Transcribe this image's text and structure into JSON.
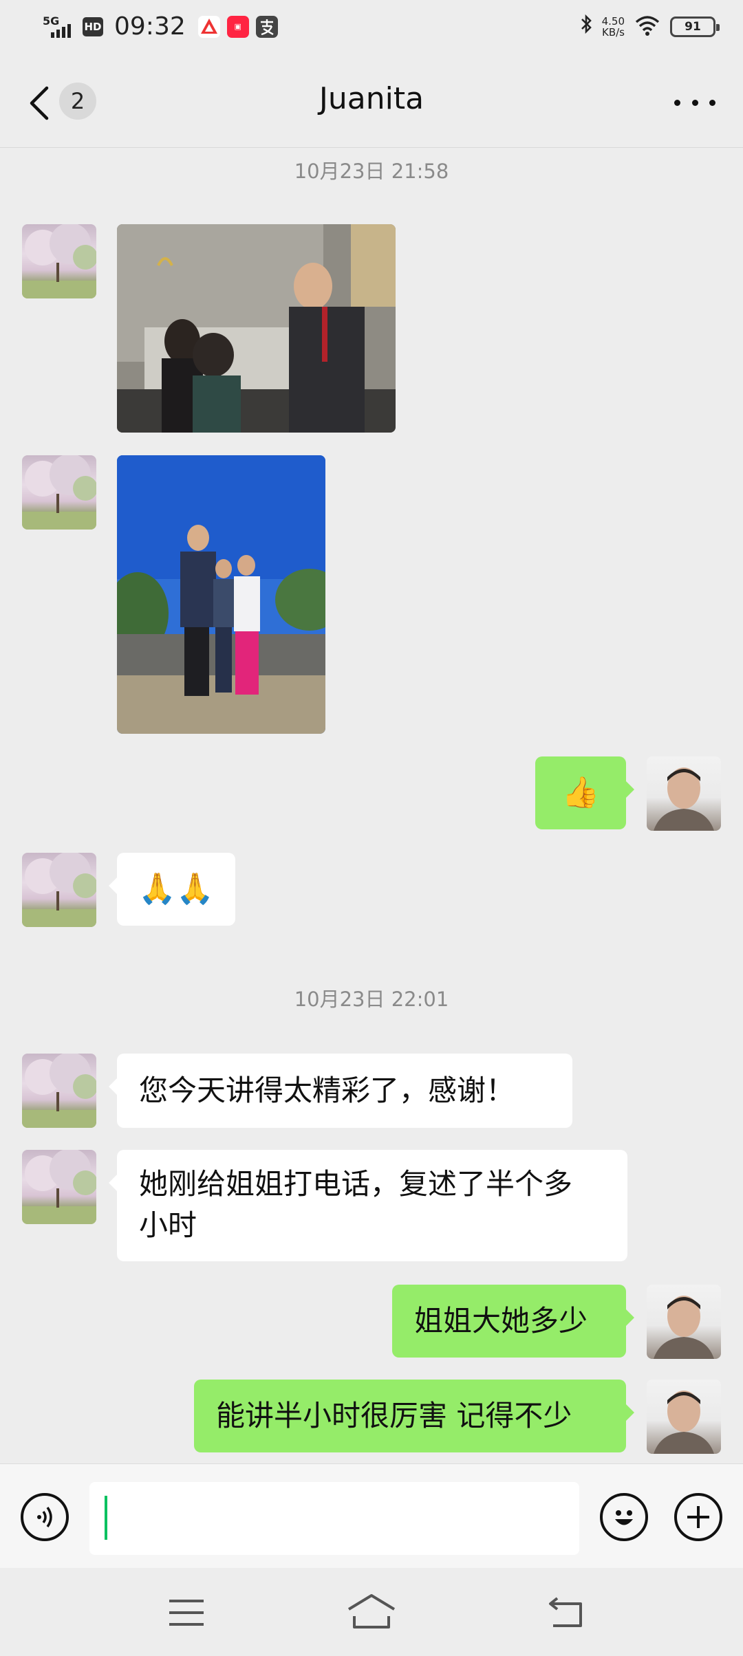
{
  "status_bar": {
    "network": "5G",
    "hd": "HD",
    "time": "09:32",
    "speed_value": "4.50",
    "speed_unit": "KB/s",
    "battery": "91"
  },
  "header": {
    "unread_count": "2",
    "title": "Juanita"
  },
  "chat": {
    "timestamp_1": "10月23日 21:58",
    "timestamp_2": "10月23日 22:01",
    "emoji_thumbs": "👍",
    "emoji_hands": "🙏🙏",
    "msg_1": "您今天讲得太精彩了，感谢！",
    "msg_2_line1": "她刚给姐姐打电话，复述了半个多",
    "msg_2_line2": "小时",
    "msg_3": "姐姐大她多少",
    "msg_4": "能讲半小时很厉害 记得不少"
  },
  "input": {
    "value": ""
  },
  "colors": {
    "sent_bubble": "#95ec69",
    "received_bubble": "#ffffff",
    "background": "#ededed",
    "caret": "#07c160"
  }
}
